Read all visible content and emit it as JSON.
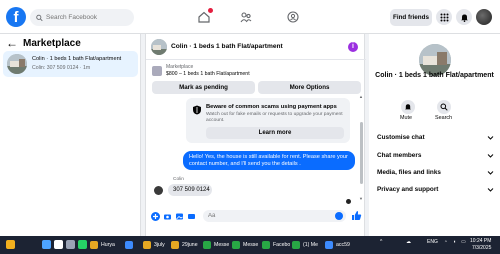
{
  "topbar": {
    "logo": "f",
    "search_placeholder": "Search Facebook",
    "find_friends_label": "Find friends",
    "nav_icons": [
      "home-icon",
      "friends-icon",
      "groups-icon"
    ],
    "accent": "#1877f2"
  },
  "left": {
    "title": "Marketplace",
    "chat": {
      "title": "Colin · 1 beds 1 bath Flat/apartment",
      "subtitle": "Colin: 307 509 0124 · 1m"
    }
  },
  "conversation": {
    "header_title": "Colin · 1 beds 1 bath Flat/apartment",
    "listing_label": "Marketplace",
    "listing_price": "$800 – 1 beds 1 bath Flat/apartment",
    "mark_pending_label": "Mark as pending",
    "more_options_label": "More Options",
    "scam_title": "Beware of common scams using payment apps",
    "scam_text": "Watch out for fake emails or requests to upgrade your payment account.",
    "learn_more_label": "Learn more",
    "outgoing_message": "Hello! Yes, the house is still available for rent. Please share your contact number, and I'll send you the details .",
    "sender_name": "Colin",
    "incoming_message": "307 509 0124",
    "composer_placeholder": "Aa",
    "outgoing_color": "#0a6cff"
  },
  "profile": {
    "name": "Colin · 1 beds 1 bath Flat/apartment",
    "mute_label": "Mute",
    "search_label": "Search",
    "menu": [
      "Customise chat",
      "Chat members",
      "Media, files and links",
      "Privacy and support"
    ]
  },
  "taskbar": {
    "apps": [
      "Hurya",
      "3july",
      "29june",
      "Messe",
      "Messe",
      "Facebo",
      "(1) Me",
      "acc59"
    ],
    "lang": "ENG",
    "time": "10:24 PM",
    "date": "7/3/2025"
  }
}
